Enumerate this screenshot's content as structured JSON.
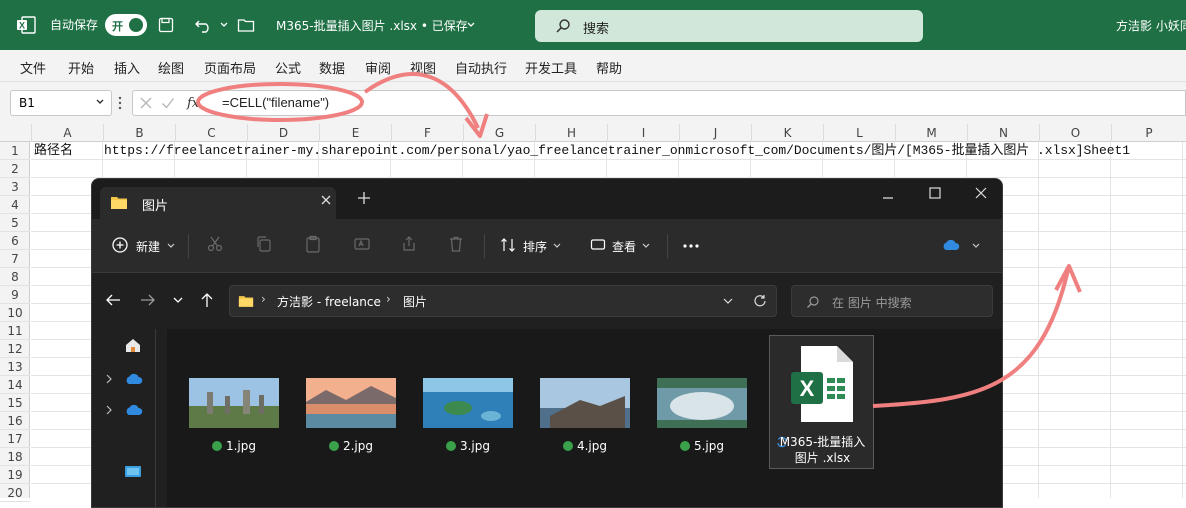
{
  "excel": {
    "autosave_label": "自动保存",
    "toggle_label": "开",
    "doc_title": "M365-批量插入图片 .xlsx • 已保存",
    "search_placeholder": "搜索",
    "user_name": "方洁影 小妖同学",
    "menu": [
      "文件",
      "开始",
      "插入",
      "绘图",
      "页面布局",
      "公式",
      "数据",
      "审阅",
      "视图",
      "自动执行",
      "开发工具",
      "帮助"
    ],
    "name_box": "B1",
    "formula": "=CELL(\"filename\")",
    "columns": [
      "A",
      "B",
      "C",
      "D",
      "E",
      "F",
      "G",
      "H",
      "I",
      "J",
      "K",
      "L",
      "M",
      "N",
      "O",
      "P"
    ],
    "rows": [
      "1",
      "2",
      "3",
      "4",
      "5",
      "6",
      "7",
      "8",
      "9",
      "10",
      "11",
      "12",
      "13",
      "14",
      "15",
      "16",
      "17",
      "18",
      "19",
      "20"
    ],
    "cell_a1": "路径名",
    "cell_b1": "https://freelancetrainer-my.sharepoint.com/personal/yao_freelancetrainer_onmicrosoft_com/Documents/图片/[M365-批量插入图片 .xlsx]Sheet1"
  },
  "explorer": {
    "tab_title": "图片",
    "toolbar": {
      "new_label": "新建",
      "sort_label": "排序",
      "view_label": "查看"
    },
    "breadcrumb": [
      "方洁影 - freelance",
      "图片"
    ],
    "search_placeholder": "在 图片 中搜索",
    "files": [
      {
        "name": "1.jpg",
        "colors": [
          "#8fb4d9",
          "#5f7a4c",
          "#7a7a6e"
        ]
      },
      {
        "name": "2.jpg",
        "colors": [
          "#f0a98a",
          "#5b8aa3",
          "#d98a6a"
        ]
      },
      {
        "name": "3.jpg",
        "colors": [
          "#2f7fb8",
          "#1b5f8a",
          "#6bb3d6"
        ]
      },
      {
        "name": "4.jpg",
        "colors": [
          "#a9c7e0",
          "#4a5a6a",
          "#d4d8dc"
        ]
      },
      {
        "name": "5.jpg",
        "colors": [
          "#6f9aa8",
          "#3f6f55",
          "#d8e4e8"
        ]
      }
    ],
    "xlsx_name": "M365-批量插入图片 .xlsx"
  },
  "colors": {
    "excel_green": "#1f7145",
    "annotation": "#f08080",
    "explorer_bg": "#202020"
  }
}
